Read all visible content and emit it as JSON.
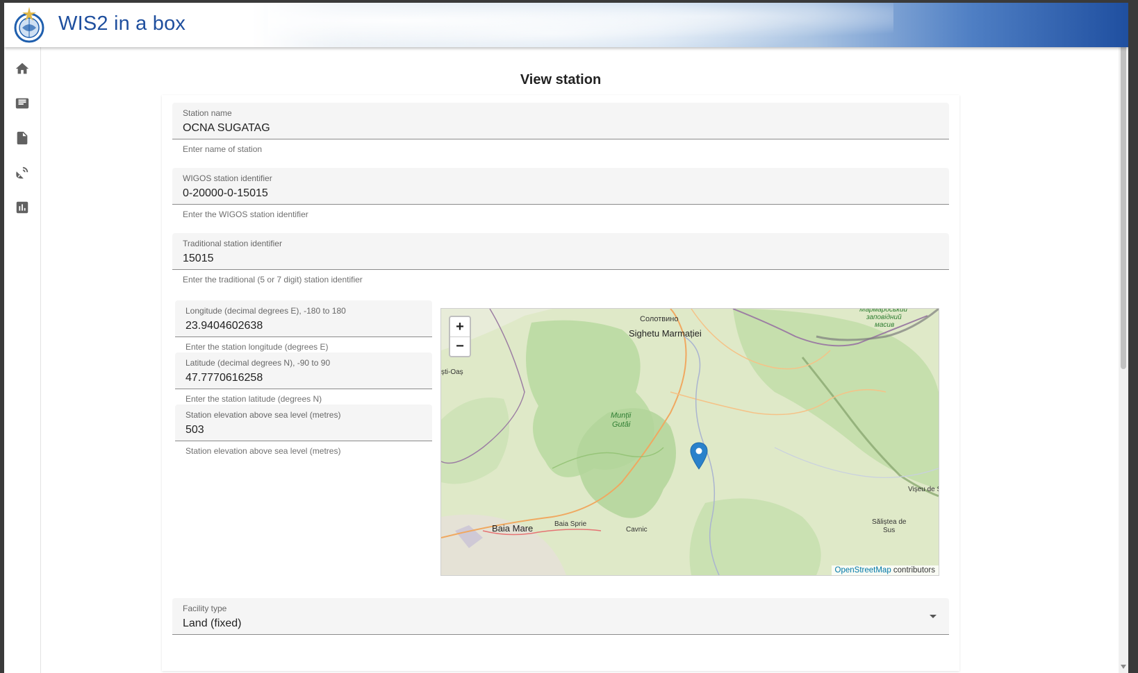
{
  "app": {
    "title": "WIS2 in a box",
    "logo_icon": "wmo-logo-icon"
  },
  "sidebar": {
    "items": [
      {
        "icon": "home-icon",
        "label": "Home"
      },
      {
        "icon": "message-icon",
        "label": "Messages"
      },
      {
        "icon": "csv-file-icon",
        "label": "Data"
      },
      {
        "icon": "satellite-dish-icon",
        "label": "Stations"
      },
      {
        "icon": "bar-chart-icon",
        "label": "Monitoring"
      }
    ]
  },
  "page": {
    "title": "View station"
  },
  "form": {
    "station_name": {
      "label": "Station name",
      "value": "OCNA SUGATAG",
      "hint": "Enter name of station"
    },
    "wigos_id": {
      "label": "WIGOS station identifier",
      "value": "0-20000-0-15015",
      "hint": "Enter the WIGOS station identifier"
    },
    "traditional_id": {
      "label": "Traditional station identifier",
      "value": "15015",
      "hint": "Enter the traditional (5 or 7 digit) station identifier"
    },
    "longitude": {
      "label": "Longitude (decimal degrees E), -180 to 180",
      "value": "23.9404602638",
      "hint": "Enter the station longitude (degrees E)"
    },
    "latitude": {
      "label": "Latitude (decimal degrees N), -90 to 90",
      "value": "47.7770616258",
      "hint": "Enter the station latitude (degrees N)"
    },
    "elevation": {
      "label": "Station elevation above sea level (metres)",
      "value": "503",
      "hint": "Station elevation above sea level (metres)"
    },
    "facility_type": {
      "label": "Facility type",
      "value": "Land (fixed)"
    }
  },
  "map": {
    "zoom_in": "+",
    "zoom_out": "−",
    "attribution_link": "OpenStreetMap",
    "attribution_text": " contributors",
    "labels": {
      "solotvyno": "Солотвино",
      "sighetu": "Sighetu Marmației",
      "oas": "ști-Oaș",
      "muntii": "Munții",
      "gutai": "Gutâi",
      "baia_mare": "Baia Mare",
      "baia_sprie": "Baia Sprie",
      "cavnic": "Cavnic",
      "viseu": "Vișeu de S",
      "salistea_1": "Săliștea de",
      "salistea_2": "Sus",
      "reserve_1": "Мармароськии",
      "reserve_2": "заповідний",
      "reserve_3": "масив"
    },
    "colors": {
      "land": "#dcebc9",
      "forest": "#b7d9a2",
      "border": "#9b7fa0",
      "road": "#f0a860"
    }
  }
}
